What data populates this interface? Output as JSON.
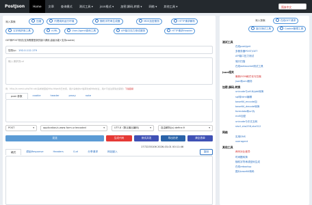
{
  "nav": {
    "brand": "PostJson",
    "items": [
      "Home",
      "文章",
      "查询模式",
      "测试工具 ▾",
      "json格式 ▾",
      "加密,解码,转换 ▾",
      "网络 ▾",
      "其他工具 ▾"
    ],
    "lang": "简体中文"
  },
  "main": {
    "quick_label": "深入探索",
    "quick_links_row1": [
      "压缩",
      "代理纯码运行环境",
      "随机字符串生成器",
      "MD5加密服务",
      "HTTP请求解析"
    ],
    "quick_links_row2": [
      "汉字转拼音工具",
      "cURL",
      "User-Agent查询工具",
      "API接口压力测试服务",
      "HTTP请求Header"
    ],
    "notice": "GET和POST测试(支持需要登录的接口调用,高级功能+支持cookie)",
    "ip_prefix": "您的ip:",
    "ip_value": "192.0.112.179",
    "url_placeholder": "输入请求的url",
    "hint": "例：http://x.com/x.php?id=ok(请求类型如http,https均已支持，用户请求的url会转化成http协议，用户不会注意到此错误)",
    "hint_red": "下载链接",
    "tabs_params": [
      "post 参数",
      "cookie",
      "header",
      "proxy",
      "note"
    ],
    "method": "POST",
    "content_type": "application/x-www-form-urlencoded",
    "charset": "UTF-8（默认输出编码)",
    "custom_regex": "自由解析(js):define.fi",
    "buttons": {
      "send": "发送",
      "gen_code": "生成代码",
      "test_speed": "测试并发",
      "export": "导出历史",
      "clear": "清空表单"
    },
    "result_tabs": [
      "格式",
      "原始Response",
      "Headers",
      "Curl",
      "分享请求",
      "网站嵌入"
    ],
    "timestamp": "1772235106 2026-03-01 00:11:46",
    "copy_label": "复制"
  },
  "side": {
    "explore_label": "深入探索",
    "top_links": [
      "在线GET请求",
      "接口测试工具",
      "Cookie管理工具"
    ],
    "sections": [
      {
        "title": "测试工具",
        "items": [
          {
            "t": "在线post/get",
            "red": false
          },
          {
            "t": "多服务器POST/GET",
            "red": false
          },
          {
            "t": "API接口压力测试",
            "red": false
          },
          {
            "t": "端口扫描",
            "red": false
          },
          {
            "t": "在线websocket测试工具",
            "red": false
          }
        ]
      },
      {
        "title": "json相关",
        "items": [
          {
            "t": "最新JSON格式化与压缩",
            "red": true
          },
          {
            "t": "json转xml服务",
            "red": false
          }
        ]
      },
      {
        "title": "加密,解码,转换",
        "items": [
          {
            "t": "unicode与utf-8/gbk转换",
            "red": false
          },
          {
            "t": "sql转html编辑",
            "red": false
          },
          {
            "t": "base64_encode加",
            "red": false
          },
          {
            "t": "base64_decode转换",
            "red": false
          },
          {
            "t": "formdata转url为",
            "red": false
          },
          {
            "t": "md5加密",
            "red": false
          },
          {
            "t": "unicode与中文互转",
            "red": false
          },
          {
            "t": "sha1,sha256,sha512",
            "red": false
          }
        ]
      },
      {
        "title": "网络",
        "items": [
          {
            "t": "实用DNS",
            "red": false
          },
          {
            "t": "useragent",
            "red": false
          }
        ]
      },
      {
        "title": "其他工具",
        "items": [
          {
            "t": "两列对比差异",
            "red": true
          },
          {
            "t": "时间戳转换",
            "red": false
          },
          {
            "t": "随机字符串或密码生成",
            "red": false
          },
          {
            "t": "在线rebootup",
            "red": false
          },
          {
            "t": "图片base64转码",
            "red": false
          }
        ]
      }
    ]
  }
}
